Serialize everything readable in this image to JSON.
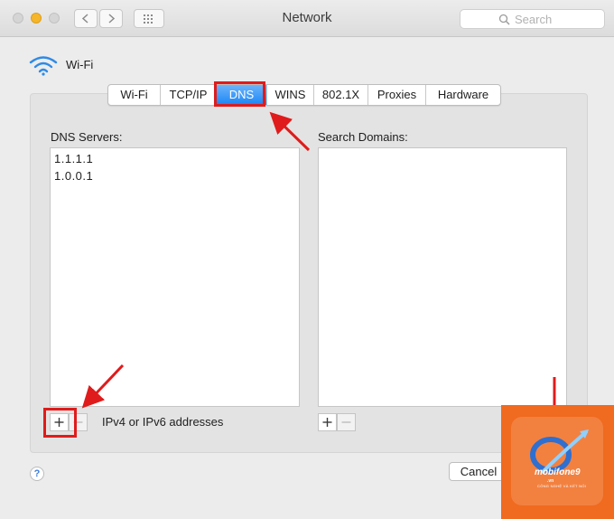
{
  "window": {
    "title": "Network"
  },
  "search": {
    "placeholder": "Search"
  },
  "interface": {
    "name": "Wi-Fi"
  },
  "tabs": [
    {
      "label": "Wi-Fi",
      "active": false
    },
    {
      "label": "TCP/IP",
      "active": false
    },
    {
      "label": "DNS",
      "active": true
    },
    {
      "label": "WINS",
      "active": false
    },
    {
      "label": "802.1X",
      "active": false
    },
    {
      "label": "Proxies",
      "active": false
    },
    {
      "label": "Hardware",
      "active": false
    }
  ],
  "dns": {
    "label": "DNS Servers:",
    "servers": [
      "1.1.1.1",
      "1.0.0.1"
    ],
    "hint": "IPv4 or IPv6 addresses"
  },
  "search_domains": {
    "label": "Search Domains:",
    "items": []
  },
  "buttons": {
    "add": "+",
    "remove": "−",
    "cancel": "Cancel",
    "help": "?"
  },
  "watermark": {
    "brand": "mobifone9",
    "domain": ".vn",
    "tagline": "CÔNG NGHỆ VÀ KẾT NỐI"
  },
  "colors": {
    "accent": "#1b86f6",
    "annotation": "#e01b1b",
    "watermark": "#f06a1f"
  },
  "icons": [
    "wifi-icon",
    "search-icon",
    "chevron-left-icon",
    "chevron-right-icon",
    "grid-icon"
  ]
}
